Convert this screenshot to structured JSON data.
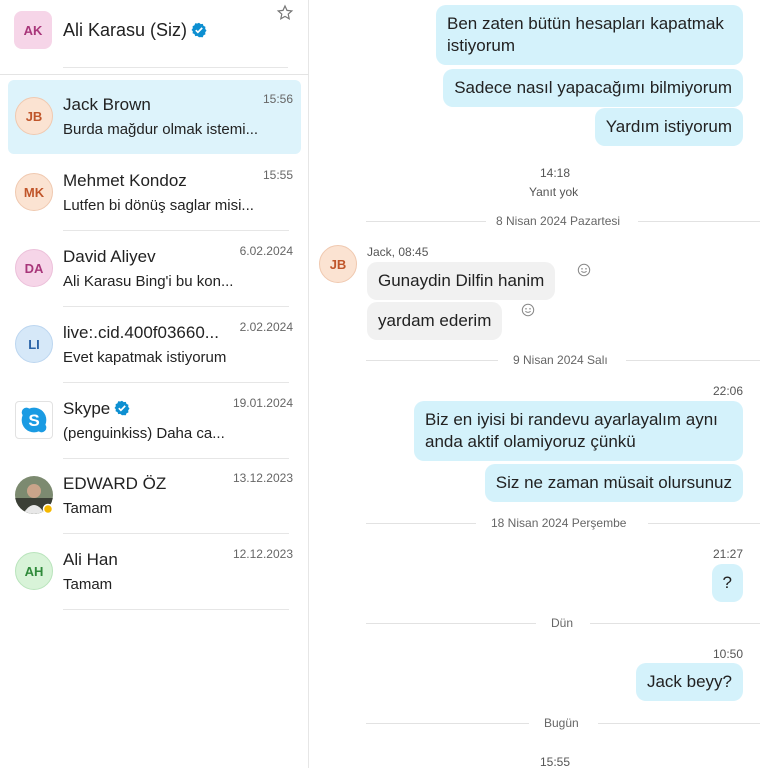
{
  "me": {
    "initials": "AK",
    "name": "Ali Karasu (Siz)",
    "verified": true
  },
  "conversations": [
    {
      "initials": "JB",
      "name": "Jack Brown",
      "preview": "Burda mağdur olmak istemi...",
      "time": "15:56",
      "active": true,
      "avatar_bg": "#fbe3d2",
      "avatar_fg": "#c0552a"
    },
    {
      "initials": "MK",
      "name": "Mehmet Kondoz",
      "preview": "Lutfen bi dönüş saglar misi...",
      "time": "15:55",
      "avatar_bg": "#fbe3d2",
      "avatar_fg": "#c0552a"
    },
    {
      "initials": "DA",
      "name": "David Aliyev",
      "preview": "Ali Karasu Bing'i bu kon...",
      "time": "6.02.2024",
      "avatar_bg": "#f6d5e8",
      "avatar_fg": "#a8367a"
    },
    {
      "initials": "LI",
      "name": "live:.cid.400f03660...",
      "preview": "Evet kapatmak istiyorum",
      "time": "2.02.2024",
      "avatar_bg": "#d6e8f8",
      "avatar_fg": "#2a64a8"
    },
    {
      "initials": "",
      "name": "Skype",
      "preview": "(penguinkiss)  Daha ca...",
      "time": "19.01.2024",
      "verified": true,
      "icon": "skype-logo-icon"
    },
    {
      "initials": "",
      "name": "EDWARD ÖZ",
      "preview": "Tamam",
      "time": "13.12.2023",
      "icon": "photo-avatar"
    },
    {
      "initials": "AH",
      "name": "Ali Han",
      "preview": "Tamam",
      "time": "12.12.2023",
      "avatar_bg": "#d8f3d8",
      "avatar_fg": "#2f8a3a"
    }
  ],
  "chat": {
    "out_top": [
      "Ben zaten bütün hesapları kapatmak istiyorum",
      "Sadece nasıl yapacağımı bilmiyorum",
      "Yardım istiyorum"
    ],
    "time_1418": "14:18",
    "no_reply": "Yanıt yok",
    "day_1": "8 Nisan 2024 Pazartesi",
    "incoming_sender": "Jack, 08:45",
    "incoming_initials": "JB",
    "incoming": [
      "Gunaydin Dilfin hanim",
      "yardam ederim"
    ],
    "day_2": "9 Nisan 2024 Salı",
    "time_2206": "22:06",
    "out_mid": [
      "Biz en iyisi bi randevu ayarlayalım aynı anda aktif olamiyoruz çünkü",
      "Siz ne zaman müsait olursunuz"
    ],
    "day_3": "18 Nisan 2024 Perşembe",
    "time_2127": "21:27",
    "question": "?",
    "day_4": "Dün",
    "time_1050": "10:50",
    "jack_beyy": "Jack beyy?",
    "day_5": "Bugün",
    "time_1555": "15:55"
  },
  "colors": {
    "active_row": "#ddf3fb",
    "bubble_out": "#d4f2fb",
    "bubble_in": "#f1f1f1",
    "verified": "#0d8fd1"
  }
}
